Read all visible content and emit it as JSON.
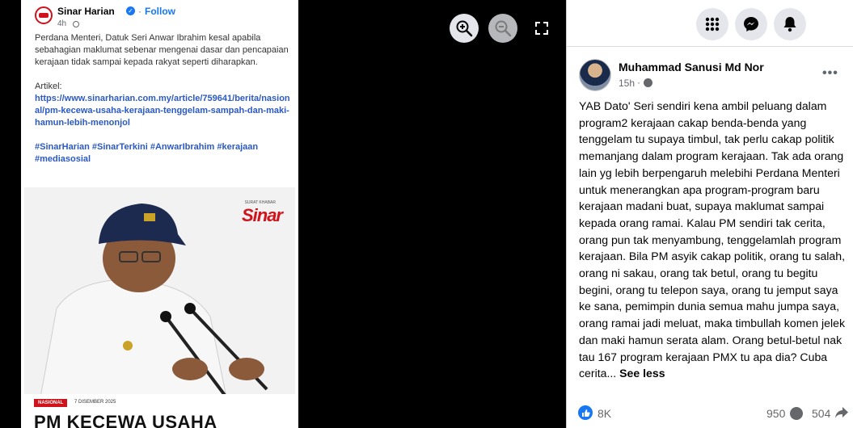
{
  "embedded_post": {
    "page_name": "Sinar Harian",
    "follow_label": "Follow",
    "time": "4h",
    "paragraph": "Perdana Menteri, Datuk Seri Anwar Ibrahim kesal apabila sebahagian maklumat sebenar mengenai dasar dan pencapaian kerajaan tidak sampai kepada rakyat seperti diharapkan.",
    "article_label": "Artikel:",
    "article_link": "https://www.sinarharian.com.my/article/759641/berita/nasional/pm-kecewa-usaha-kerajaan-tenggelam-sampah-dan-maki-hamun-lebih-menonjol",
    "hashtags": "#SinarHarian #SinarTerkini #AnwarIbrahim #kerajaan #mediasosial",
    "photo": {
      "logo_text": "Sinar",
      "logo_small": "SURAT KHABAR",
      "tag": "NASIONAL",
      "date": "7 DISEMBER 2025",
      "headline": "PM KECEWA USAHA"
    }
  },
  "viewer": {
    "icons": [
      "zoom-in-icon",
      "zoom-out-icon",
      "fullscreen-icon"
    ]
  },
  "top_bar": {
    "icons": [
      "menu-grid-icon",
      "messenger-icon",
      "bell-icon"
    ]
  },
  "post": {
    "author": "Muhammad Sanusi Md Nor",
    "time": "15h",
    "text": "YAB Dato' Seri sendiri kena ambil peluang dalam program2 kerajaan cakap benda-benda yang tenggelam tu supaya timbul, tak perlu cakap politik memanjang dalam program kerajaan. Tak ada orang lain yg lebih berpengaruh melebihi Perdana Menteri untuk menerangkan apa program-program baru kerajaan madani buat, supaya maklumat sampai kepada orang ramai. Kalau PM sendiri tak cerita, orang pun tak menyambung, tenggelamlah program kerajaan. Bila PM asyik cakap politik, orang tu salah, orang ni sakau, orang tak betul, orang tu begitu begini, orang tu telepon saya, orang tu jemput saya ke sana, pemimpin dunia semua mahu jumpa saya, orang ramai jadi meluat, maka timbullah komen jelek dan maki hamun serata alam. Orang betul-betul nak tau 167 program kerajaan PMX tu apa dia? Cuba cerita...",
    "see_less": "See less",
    "likes": "8K",
    "comments": "950",
    "shares": "504"
  },
  "colors": {
    "facebook_blue": "#1877f2",
    "sinar_red": "#d0121b",
    "link_blue": "#2b59c3"
  }
}
